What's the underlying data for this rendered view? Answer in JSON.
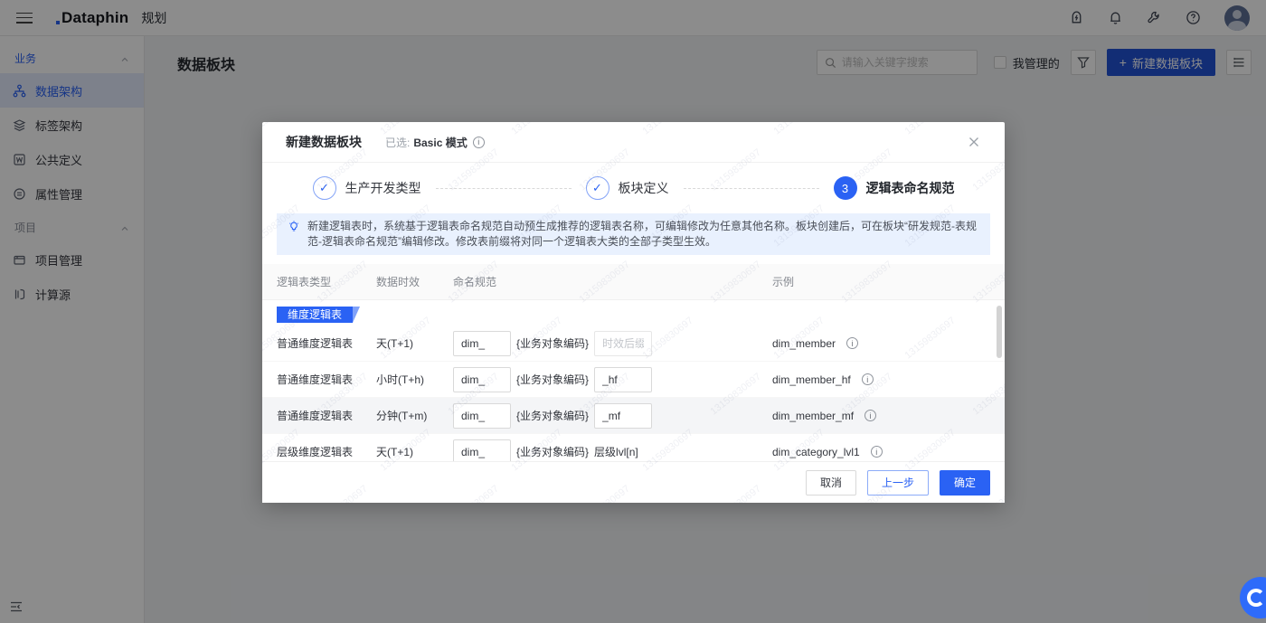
{
  "topbar": {
    "product": "Dataphin",
    "module": "规划"
  },
  "sidebar": {
    "sections": [
      {
        "label": "业务",
        "items": [
          {
            "label": "数据架构"
          },
          {
            "label": "标签架构"
          },
          {
            "label": "公共定义"
          },
          {
            "label": "属性管理"
          }
        ]
      },
      {
        "label": "项目",
        "items": [
          {
            "label": "项目管理"
          },
          {
            "label": "计算源"
          }
        ]
      }
    ]
  },
  "page": {
    "title": "数据板块",
    "search_placeholder": "请输入关键字搜索",
    "my_managed_label": "我管理的",
    "create_label": "新建数据板块"
  },
  "modal": {
    "title": "新建数据板块",
    "selected_label": "已选:",
    "selected_value": "Basic 模式",
    "steps": [
      {
        "label": "生产开发类型",
        "state": "done"
      },
      {
        "label": "板块定义",
        "state": "done"
      },
      {
        "label": "逻辑表命名规范",
        "state": "current",
        "number": "3"
      }
    ],
    "notice": "新建逻辑表时，系统基于逻辑表命名规范自动预生成推荐的逻辑表名称，可编辑修改为任意其他名称。板块创建后，可在板块“研发规范-表规范-逻辑表命名规范”编辑修改。修改表前缀将对同一个逻辑表大类的全部子类型生效。",
    "table": {
      "headers": [
        "逻辑表类型",
        "数据时效",
        "命名规范",
        "示例"
      ],
      "group_tag": "维度逻辑表",
      "rows": [
        {
          "type": "普通维度逻辑表",
          "timeliness": "天(T+1)",
          "prefix": "dim_",
          "pattern": "{业务对象编码}",
          "suffix_placeholder": "时效后缀",
          "example": "dim_member"
        },
        {
          "type": "普通维度逻辑表",
          "timeliness": "小时(T+h)",
          "prefix": "dim_",
          "pattern": "{业务对象编码}",
          "suffix": "_hf",
          "example": "dim_member_hf"
        },
        {
          "type": "普通维度逻辑表",
          "timeliness": "分钟(T+m)",
          "prefix": "dim_",
          "pattern": "{业务对象编码}",
          "suffix": "_mf",
          "example": "dim_member_mf"
        },
        {
          "type": "层级维度逻辑表",
          "timeliness": "天(T+1)",
          "prefix": "dim_",
          "pattern": "{业务对象编码}",
          "suffix_text": "层级lvl[n]",
          "example": "dim_category_lvl1"
        }
      ]
    },
    "footer": {
      "cancel": "取消",
      "prev": "上一步",
      "ok": "确定"
    }
  },
  "watermark": {
    "text": "13159830697"
  },
  "colors": {
    "accent": "#2a62f4",
    "primary_button": "#2253d6",
    "notice_bg": "#e9f1fe",
    "overlay": "rgba(0,0,0,0.45)"
  }
}
